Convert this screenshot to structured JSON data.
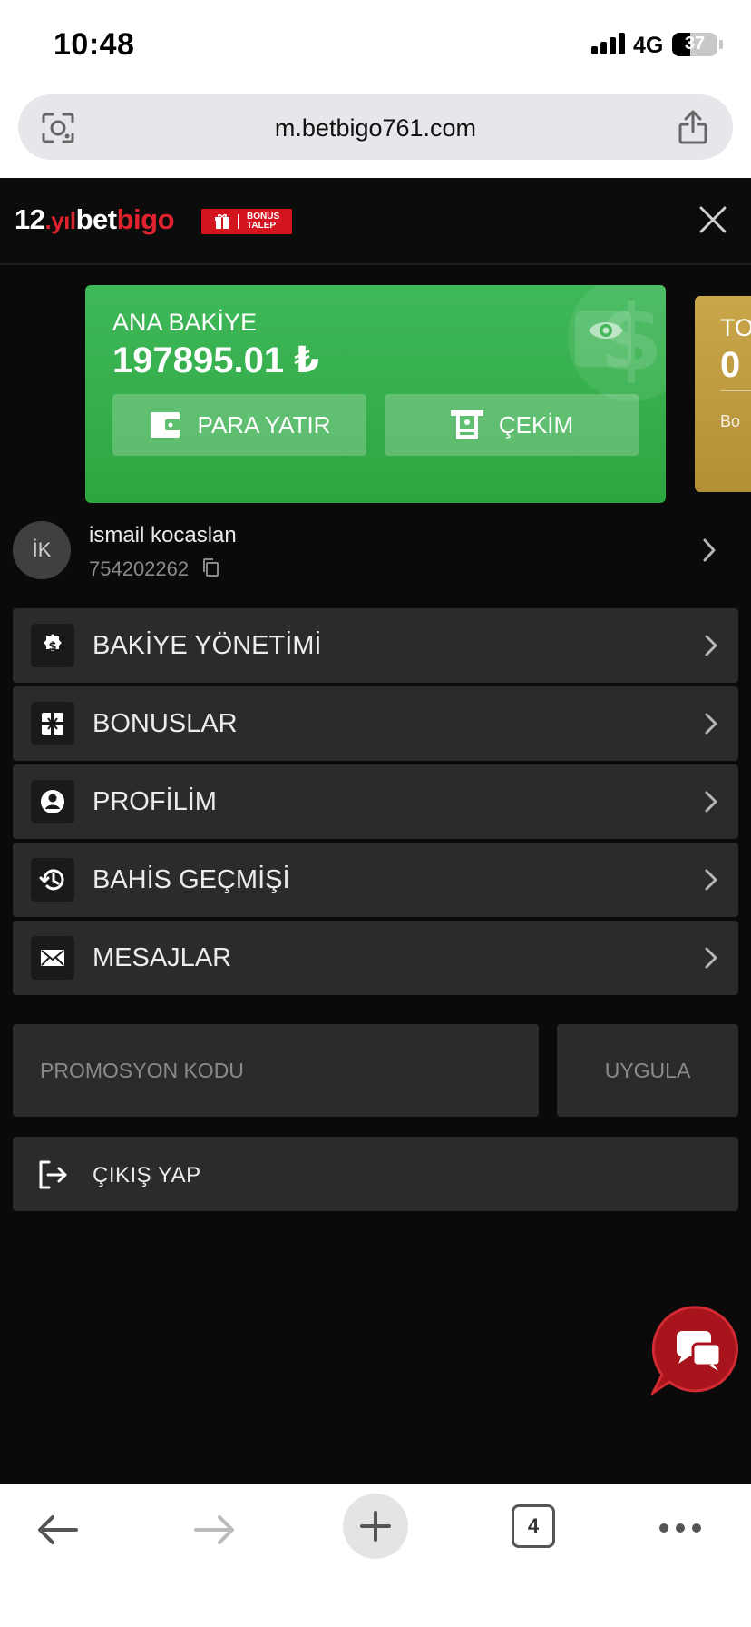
{
  "status_bar": {
    "time": "10:48",
    "network": "4G",
    "battery": "37"
  },
  "browser": {
    "url": "m.betbigo761.com",
    "tab_count": "4"
  },
  "header": {
    "logo_num": "12",
    "logo_yil": ".yıl",
    "logo_bet": "bet",
    "logo_bigo": "bigo",
    "bonus_line1": "BONUS",
    "bonus_line2": "TALEP"
  },
  "balance": {
    "label": "ANA BAKİYE",
    "amount": "197895.01 ₺",
    "deposit_label": "PARA YATIR",
    "withdraw_label": "ÇEKİM"
  },
  "balance2": {
    "title": "TO",
    "value": "0",
    "sub": "Bo"
  },
  "user": {
    "initials": "İK",
    "name": "ismail kocaslan",
    "id": "754202262"
  },
  "menu": [
    {
      "label": "BAKİYE YÖNETİMİ",
      "icon": "balance-settings-icon"
    },
    {
      "label": "BONUSLAR",
      "icon": "bonus-gift-icon"
    },
    {
      "label": "PROFİLİM",
      "icon": "profile-icon"
    },
    {
      "label": "BAHİS GEÇMİŞİ",
      "icon": "history-icon"
    },
    {
      "label": "MESAJLAR",
      "icon": "mail-icon"
    }
  ],
  "promo": {
    "placeholder": "PROMOSYON KODU",
    "apply_label": "UYGULA"
  },
  "logout": {
    "label": "ÇIKIŞ YAP"
  },
  "colors": {
    "balance_green": "#2ea63f",
    "accent_red": "#d3151f",
    "gold": "#c9a64a",
    "menu_bg": "#2b2b2b"
  }
}
